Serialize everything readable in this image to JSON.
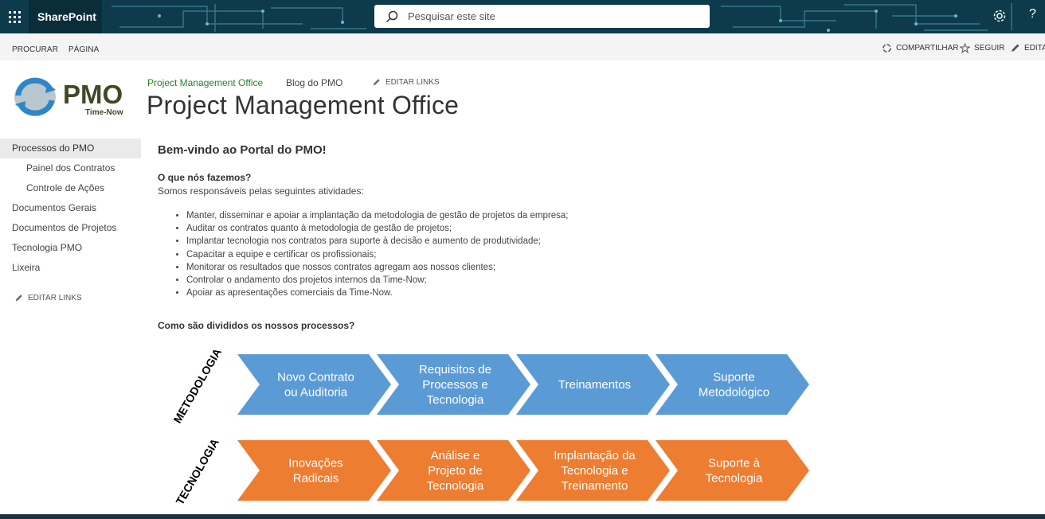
{
  "suitebar": {
    "brand": "SharePoint",
    "search_placeholder": "Pesquisar este site",
    "help": "?"
  },
  "ribbon": {
    "tabs": [
      "PROCURAR",
      "PÁGINA"
    ],
    "share": "COMPARTILHAR",
    "follow": "SEGUIR",
    "edit": "EDITA"
  },
  "header": {
    "logo_text": "PMO",
    "logo_subtext": "Time-Now",
    "top_links": [
      "Project Management Office",
      "Blog do PMO"
    ],
    "edit_links": "EDITAR LINKS",
    "site_title": "Project Management Office"
  },
  "nav": {
    "items": [
      {
        "label": "Processos do PMO",
        "selected": true,
        "sub": false
      },
      {
        "label": "Painel dos Contratos",
        "selected": false,
        "sub": true
      },
      {
        "label": "Controle de Ações",
        "selected": false,
        "sub": true
      },
      {
        "label": "Documentos Gerais",
        "selected": false,
        "sub": false
      },
      {
        "label": "Documentos de Projetos",
        "selected": false,
        "sub": false
      },
      {
        "label": "Tecnologia PMO",
        "selected": false,
        "sub": false
      },
      {
        "label": "Lixeira",
        "selected": false,
        "sub": false
      }
    ],
    "edit_links": "EDITAR LINKS"
  },
  "main": {
    "welcome": "Bem-vindo ao Portal do PMO!",
    "what_heading": "O que nós fazemos?",
    "intro": "Somos responsáveis pelas seguintes atividades:",
    "bullets": [
      "Manter, disseminar e apoiar a implantação da metodologia de gestão de projetos da empresa;",
      "Auditar os contratos quanto à metodologia de gestão de projetos;",
      "Implantar tecnologia nos contratos para suporte à decisão e aumento de produtividade;",
      "Capacitar a equipe e certificar os profissionais;",
      "Monitorar os resultados que nossos contratos agregam aos nossos clientes;",
      "Controlar o andamento dos projetos internos da Time-Now;",
      "Apoiar as apresentações comerciais da Time-Now."
    ],
    "how_heading": "Como são divididos os nossos processos?"
  },
  "diagram": {
    "rows": [
      {
        "label": "METODOLOGIA",
        "color": "#5b9bd5",
        "steps": [
          [
            "Novo Contrato",
            "ou Auditoria"
          ],
          [
            "Requisitos de",
            "Processos e",
            "Tecnologia"
          ],
          [
            "Treinamentos"
          ],
          [
            "Suporte",
            "Metodológico"
          ]
        ]
      },
      {
        "label": "TECNOLOGIA",
        "color": "#ed7d31",
        "steps": [
          [
            "Inovações",
            "Radicais"
          ],
          [
            "Análise e",
            "Projeto de",
            "Tecnologia"
          ],
          [
            "Implantação da",
            "Tecnologia e",
            "Treinamento"
          ],
          [
            "Suporte à",
            "Tecnologia"
          ]
        ]
      }
    ]
  }
}
